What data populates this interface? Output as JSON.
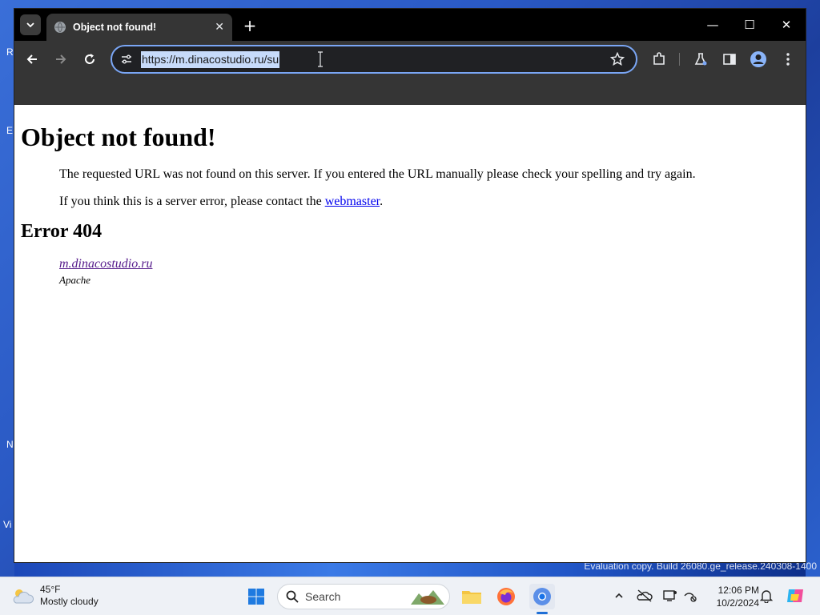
{
  "desktop": {
    "icon_letters": [
      "R",
      "E",
      "N",
      "Vi"
    ],
    "watermark": "Evaluation copy. Build 26080.ge_release.240308-1400"
  },
  "browser": {
    "tab": {
      "title": "Object not found!",
      "favicon": "globe-icon",
      "close": "✕"
    },
    "new_tab": "+",
    "window_controls": {
      "minimize": "—",
      "maximize": "☐",
      "close": "✕"
    },
    "address_bar": {
      "url": "https://m.dinacostudio.ru/su"
    }
  },
  "page": {
    "title": "Object not found!",
    "paragraph1": "The requested URL was not found on this server. If you entered the URL manually please check your spelling and try again.",
    "paragraph2_prefix": "If you think this is a server error, please contact the ",
    "webmaster_link": "webmaster",
    "paragraph2_suffix": ".",
    "error_heading": "Error 404",
    "server_link": "m.dinacostudio.ru",
    "server_software": "Apache"
  },
  "taskbar": {
    "weather": {
      "temp": "45°F",
      "condition": "Mostly cloudy"
    },
    "search_label": "Search",
    "clock": {
      "time": "12:06 PM",
      "date": "10/2/2024"
    }
  },
  "colors": {
    "titlebar": "#000000",
    "toolbar": "#353535",
    "omnibox_border": "#7aa6f5",
    "link": "#0000ee",
    "visited_link": "#551a8b"
  }
}
